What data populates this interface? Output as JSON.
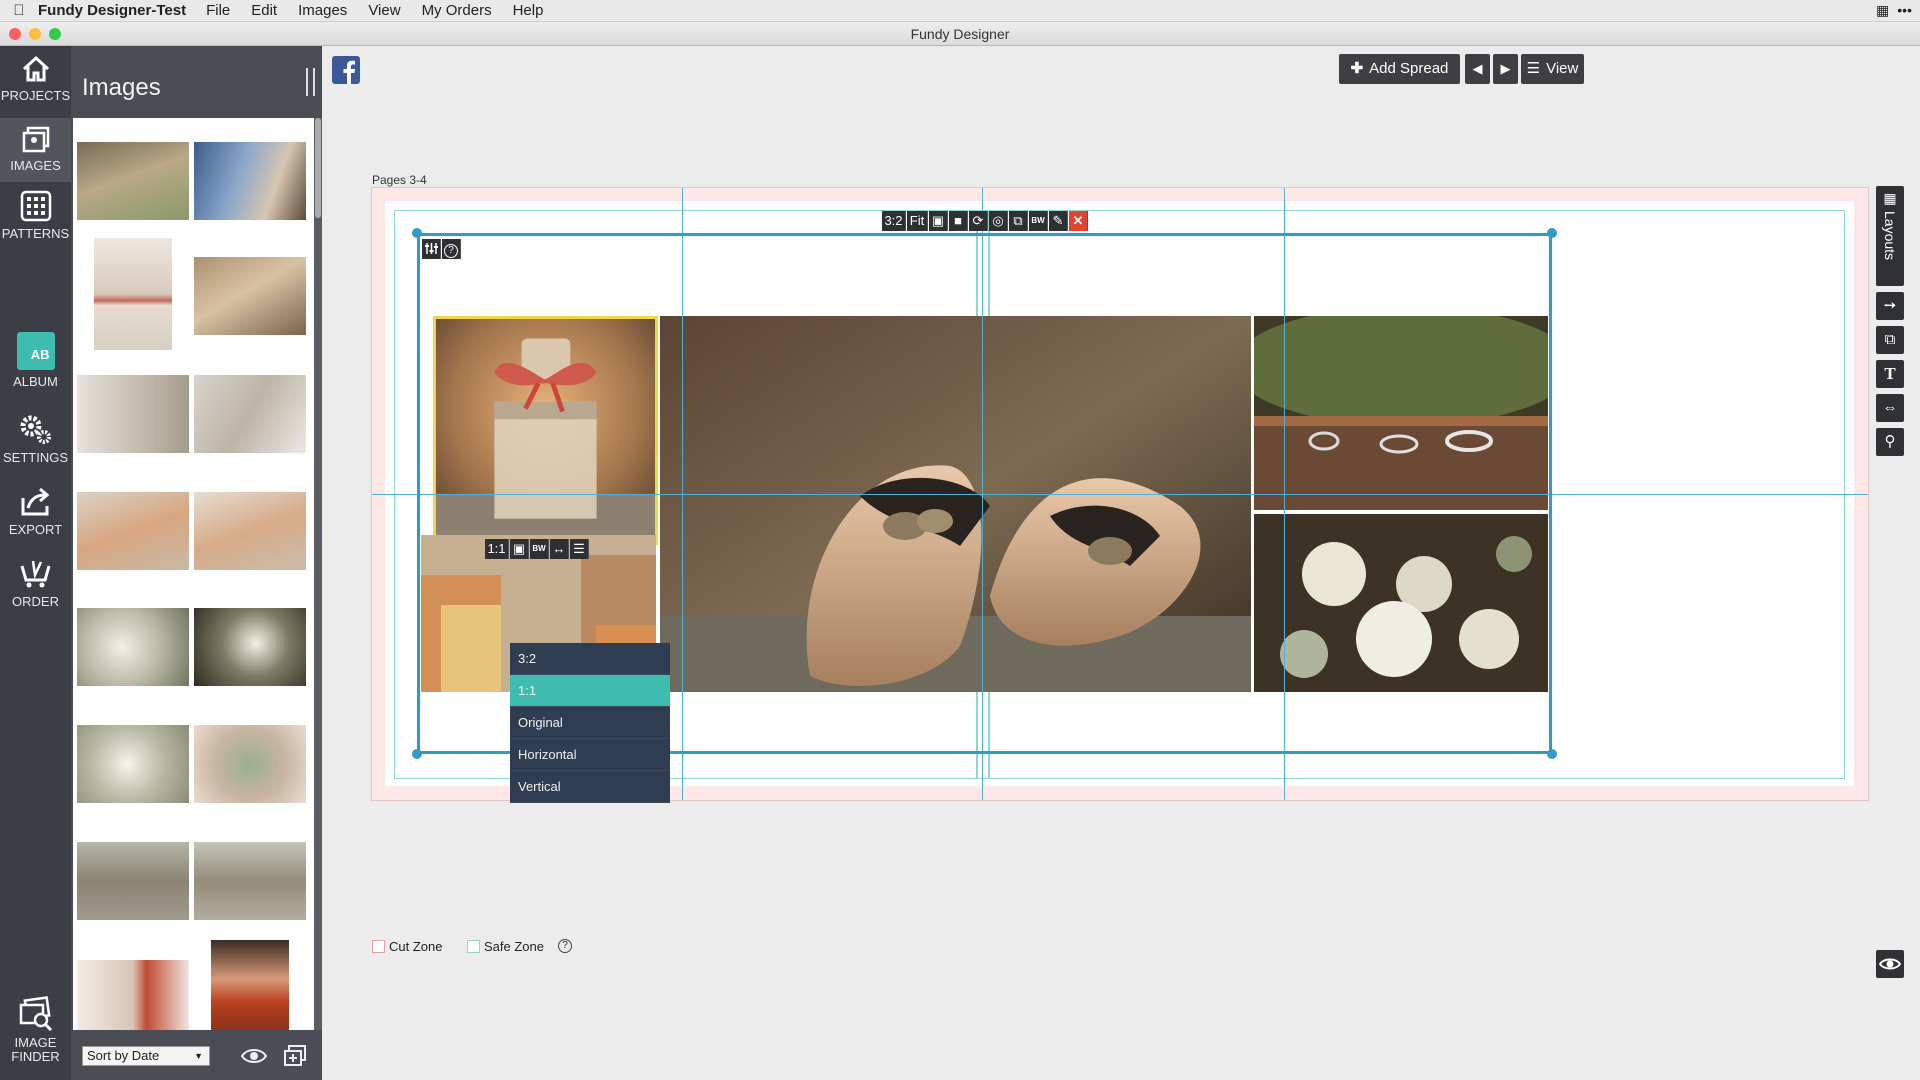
{
  "menubar": {
    "app_name": "Fundy Designer-Test",
    "menus": [
      "File",
      "Edit",
      "Images",
      "View",
      "My Orders",
      "Help"
    ]
  },
  "window": {
    "title": "Fundy Designer"
  },
  "leftnav": {
    "items": [
      {
        "label": "PROJECTS",
        "icon": "home-icon"
      },
      {
        "label": "IMAGES",
        "icon": "images-icon"
      },
      {
        "label": "PATTERNS",
        "icon": "grid-icon"
      },
      {
        "label": "ALBUM",
        "icon": "album-icon",
        "badge": "AB"
      },
      {
        "label": "SETTINGS",
        "icon": "gear-icon"
      },
      {
        "label": "EXPORT",
        "icon": "export-icon"
      },
      {
        "label": "ORDER",
        "icon": "cart-icon"
      },
      {
        "label": "IMAGE",
        "label2": "FINDER",
        "icon": "image-finder-icon"
      }
    ]
  },
  "images_panel": {
    "title": "Images",
    "sort_label": "Sort by Date"
  },
  "toolbar": {
    "add_spread": "Add Spread",
    "view": "View"
  },
  "spread": {
    "label": "Pages 3-4",
    "top_toolbar": [
      "3:2",
      "Fit"
    ],
    "photo_toolbar_ratio": "1:1",
    "bw_label": "BW",
    "crop_menu": [
      {
        "label": "3:2",
        "selected": false
      },
      {
        "label": "1:1",
        "selected": true
      },
      {
        "label": "Original",
        "selected": false
      },
      {
        "label": "Horizontal",
        "selected": false
      },
      {
        "label": "Vertical",
        "selected": false
      }
    ]
  },
  "rightbar": {
    "layouts_label": "Layouts"
  },
  "footer": {
    "cut_zone": "Cut Zone",
    "safe_zone": "Safe Zone"
  },
  "colors": {
    "accent_teal": "#3dbcaf",
    "guide_blue": "#52b0d8",
    "selection_yellow": "#f3d54a",
    "delete_red": "#e0432f",
    "nav_dark": "#3b3e44"
  }
}
